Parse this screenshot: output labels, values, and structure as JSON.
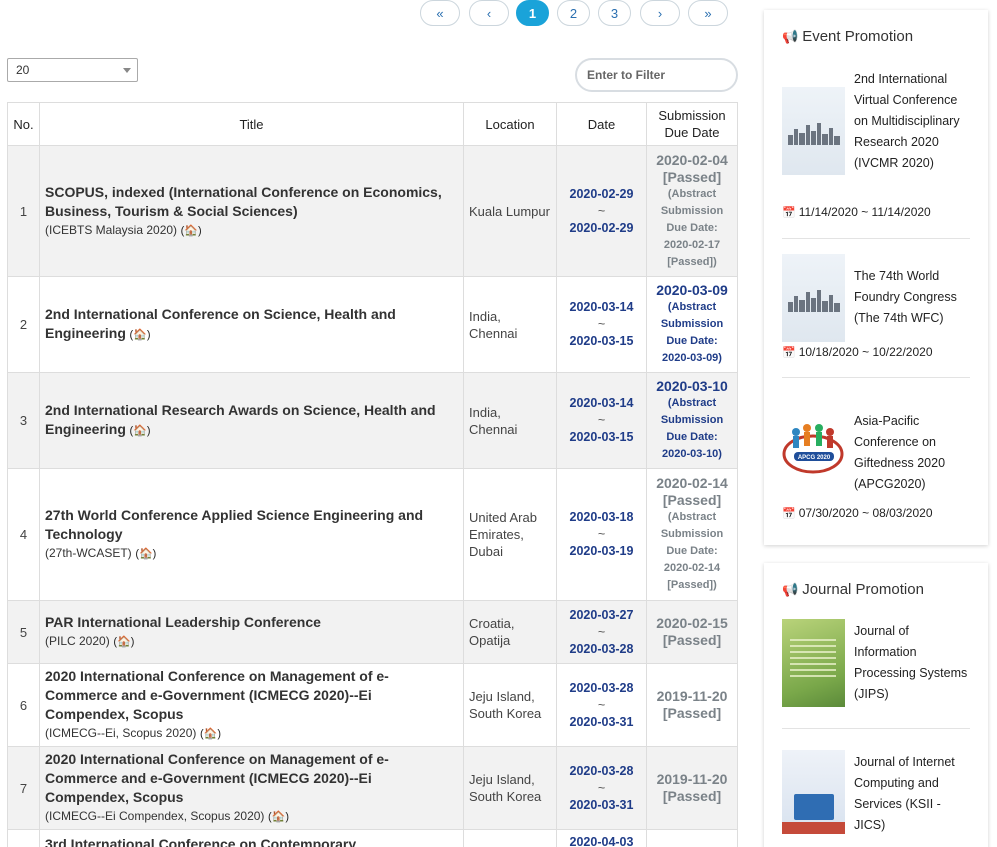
{
  "pagination": {
    "first": "«",
    "prev": "‹",
    "pages": [
      "1",
      "2",
      "3"
    ],
    "active_page": "1",
    "next": "›",
    "last": "»"
  },
  "page_size": {
    "value": "20"
  },
  "filter": {
    "placeholder": "Enter to Filter"
  },
  "table": {
    "headers": {
      "no": "No.",
      "title": "Title",
      "location": "Location",
      "date": "Date",
      "submission": "Submission Due Date"
    },
    "home_icon": "home-icon",
    "rows": [
      {
        "no": "1",
        "title": "SCOPUS, indexed (International Conference on Economics, Business, Tourism & Social Sciences)",
        "acronym": "(ICEBTS Malaysia 2020)",
        "location": "Kuala Lumpur",
        "start": "2020-02-29",
        "end": "2020-02-29",
        "submission": "2020-02-04",
        "status": "[Passed]",
        "note": "(Abstract Submission Due Date: 2020-02-17 [Passed])"
      },
      {
        "no": "2",
        "title": "2nd International Conference on Science, Health and Engineering",
        "acronym": "",
        "location": "India, Chennai",
        "start": "2020-03-14",
        "end": "2020-03-15",
        "submission": "2020-03-09",
        "status": "",
        "note": "(Abstract Submission Due Date: 2020-03-09)"
      },
      {
        "no": "3",
        "title": "2nd International Research Awards on Science, Health and Engineering",
        "acronym": "",
        "location": "India, Chennai",
        "start": "2020-03-14",
        "end": "2020-03-15",
        "submission": "2020-03-10",
        "status": "",
        "note": "(Abstract Submission Due Date: 2020-03-10)"
      },
      {
        "no": "4",
        "title": "27th World Conference Applied Science Engineering and Technology",
        "acronym": "(27th-WCASET)",
        "location": "United Arab Emirates, Dubai",
        "start": "2020-03-18",
        "end": "2020-03-19",
        "submission": "2020-02-14",
        "status": "[Passed]",
        "note": "(Abstract Submission Due Date: 2020-02-14 [Passed])"
      },
      {
        "no": "5",
        "title": "PAR International Leadership Conference",
        "acronym": "(PILC 2020)",
        "location": "Croatia, Opatija",
        "start": "2020-03-27",
        "end": "2020-03-28",
        "submission": "2020-02-15",
        "status": "[Passed]",
        "note": ""
      },
      {
        "no": "6",
        "title": "2020 International Conference on Management of e-Commerce and e-Government (ICMECG 2020)--Ei Compendex, Scopus",
        "acronym": "(ICMECG--Ei, Scopus 2020)",
        "location": "Jeju Island, South Korea",
        "start": "2020-03-28",
        "end": "2020-03-31",
        "submission": "2019-11-20",
        "status": "[Passed]",
        "note": ""
      },
      {
        "no": "7",
        "title": "2020 International Conference on Management of e-Commerce and e-Government (ICMECG 2020)--Ei Compendex, Scopus",
        "acronym": "(ICMECG--Ei Compendex, Scopus 2020)",
        "location": "Jeju Island, South Korea",
        "start": "2020-03-28",
        "end": "2020-03-31",
        "submission": "2019-11-20",
        "status": "[Passed]",
        "note": ""
      },
      {
        "no": "",
        "title": "3rd International Conference on Contemporary",
        "acronym": "",
        "location": "",
        "start": "2020-04-03",
        "end": "",
        "submission": "",
        "status": "",
        "note": ""
      }
    ]
  },
  "event_promotion": {
    "title": "Event Promotion",
    "items": [
      {
        "name": "2nd International Virtual Conference on Multidisciplinary Research 2020 (IVCMR 2020)",
        "dates": "11/14/2020 ~ 11/14/2020"
      },
      {
        "name": "The 74th World Foundry Congress (The 74th WFC)",
        "dates": "10/18/2020 ~ 10/22/2020"
      },
      {
        "name": "Asia-Pacific Conference on Giftedness 2020 (APCG2020)",
        "dates": "07/30/2020 ~ 08/03/2020"
      }
    ],
    "logo_text": "APCG 2020"
  },
  "journal_promotion": {
    "title": "Journal Promotion",
    "items": [
      {
        "name": "Journal of Information Processing Systems (JIPS)"
      },
      {
        "name": "Journal of Internet Computing and Services (KSII - JICS)"
      }
    ]
  }
}
